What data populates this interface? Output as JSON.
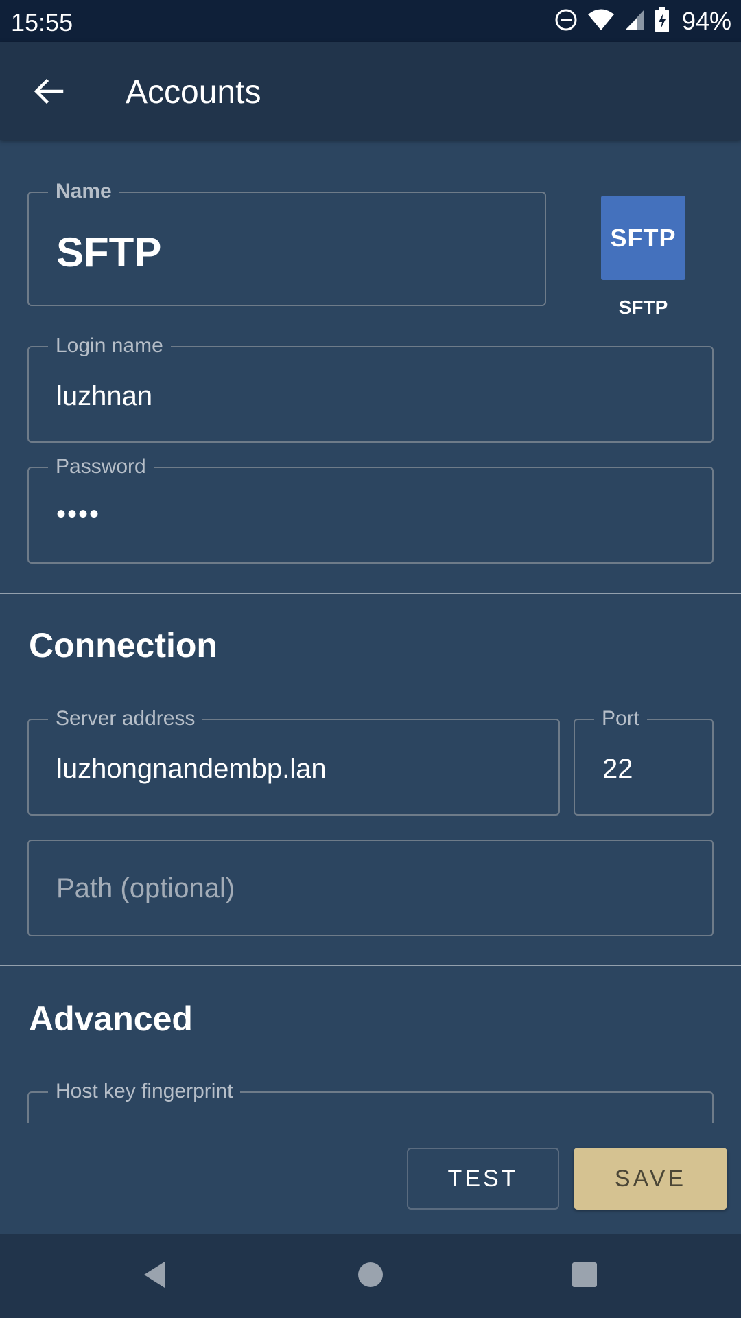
{
  "status_bar": {
    "time": "15:55",
    "battery_percent": "94%",
    "icons": [
      "do-not-disturb-icon",
      "wifi-icon",
      "signal-icon",
      "battery-charging-icon"
    ]
  },
  "app_bar": {
    "title": "Accounts",
    "back_icon": "arrow-back-icon"
  },
  "account": {
    "name_label": "Name",
    "name_value": "SFTP",
    "login_label": "Login name",
    "login_value": "luzhnan",
    "password_label": "Password",
    "password_value": "••••",
    "type_tile": "SFTP",
    "type_caption": "SFTP"
  },
  "connection": {
    "title": "Connection",
    "server_label": "Server address",
    "server_value": "luzhongnandembp.lan",
    "port_label": "Port",
    "port_value": "22",
    "path_placeholder": "Path (optional)"
  },
  "advanced": {
    "title": "Advanced",
    "fingerprint_label": "Host key fingerprint"
  },
  "buttons": {
    "test": "TEST",
    "save": "SAVE"
  },
  "colors": {
    "background": "#2c4560",
    "app_bar": "#21344b",
    "status_bar": "#0f2039",
    "accent_save": "#d5c291",
    "sftp_tile": "#4471bd"
  },
  "nav_bar": {
    "icons": [
      "back-triangle-icon",
      "home-circle-icon",
      "recents-square-icon"
    ]
  }
}
